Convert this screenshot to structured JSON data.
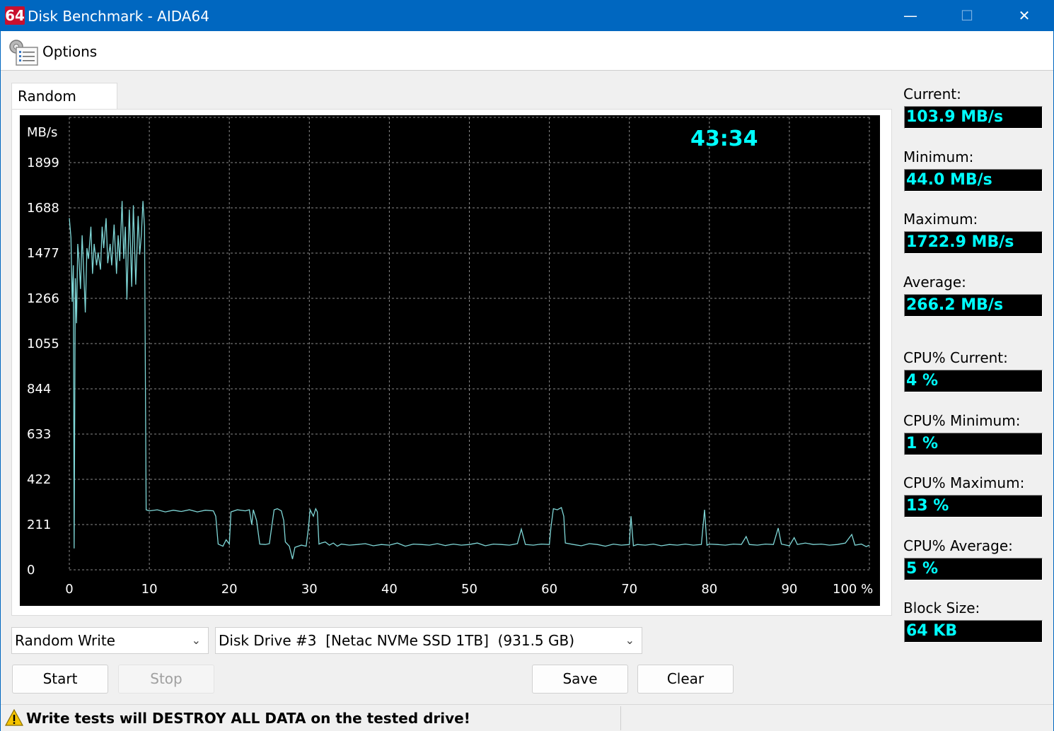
{
  "window": {
    "app_icon_text": "64",
    "title": "Disk Benchmark - AIDA64",
    "minimize_glyph": "—",
    "maximize_glyph": "☐",
    "close_glyph": "✕"
  },
  "menu": {
    "options_label": "Options",
    "options_icon": "options-icon"
  },
  "tab": {
    "label": "Random Write"
  },
  "chart_data": {
    "type": "line",
    "ylabel": "MB/s",
    "xlabel": "",
    "x_unit_suffix": "%",
    "timer_text": "43:34",
    "y_ticks": [
      0,
      211,
      422,
      633,
      844,
      1055,
      1266,
      1477,
      1688,
      1899
    ],
    "x_ticks": [
      "0",
      "10",
      "20",
      "30",
      "40",
      "50",
      "60",
      "70",
      "80",
      "90",
      "100 %"
    ],
    "xlim": [
      0,
      100
    ],
    "ylim": [
      0,
      2110
    ],
    "grid": true,
    "line_color": "#7fd7d7",
    "series": [
      {
        "values": [
          [
            0.0,
            1640
          ],
          [
            0.2,
            1550
          ],
          [
            0.35,
            1250
          ],
          [
            0.5,
            1420
          ],
          [
            0.6,
            100
          ],
          [
            0.75,
            1360
          ],
          [
            0.9,
            1150
          ],
          [
            1.05,
            1520
          ],
          [
            1.2,
            1450
          ],
          [
            1.4,
            1310
          ],
          [
            1.6,
            1560
          ],
          [
            1.8,
            1390
          ],
          [
            2.0,
            1200
          ],
          [
            2.2,
            1500
          ],
          [
            2.4,
            1450
          ],
          [
            2.7,
            1600
          ],
          [
            2.9,
            1380
          ],
          [
            3.1,
            1520
          ],
          [
            3.4,
            1420
          ],
          [
            3.6,
            1480
          ],
          [
            3.9,
            1400
          ],
          [
            4.1,
            1600
          ],
          [
            4.3,
            1500
          ],
          [
            4.6,
            1640
          ],
          [
            4.8,
            1430
          ],
          [
            5.1,
            1520
          ],
          [
            5.3,
            1420
          ],
          [
            5.6,
            1610
          ],
          [
            5.9,
            1380
          ],
          [
            6.1,
            1560
          ],
          [
            6.3,
            1440
          ],
          [
            6.6,
            1720
          ],
          [
            6.8,
            1450
          ],
          [
            7.0,
            1600
          ],
          [
            7.2,
            1260
          ],
          [
            7.5,
            1680
          ],
          [
            7.8,
            1320
          ],
          [
            8.0,
            1700
          ],
          [
            8.3,
            1330
          ],
          [
            8.6,
            1650
          ],
          [
            8.8,
            1470
          ],
          [
            9.0,
            1560
          ],
          [
            9.2,
            1720
          ],
          [
            9.4,
            1600
          ],
          [
            9.6,
            280
          ],
          [
            10,
            275
          ],
          [
            11,
            280
          ],
          [
            12,
            270
          ],
          [
            13,
            278
          ],
          [
            14,
            272
          ],
          [
            15,
            280
          ],
          [
            16,
            270
          ],
          [
            17,
            278
          ],
          [
            18,
            275
          ],
          [
            18.3,
            250
          ],
          [
            18.6,
            120
          ],
          [
            19.2,
            110
          ],
          [
            19.6,
            140
          ],
          [
            20,
            120
          ],
          [
            20.2,
            270
          ],
          [
            21,
            280
          ],
          [
            22,
            275
          ],
          [
            22.5,
            280
          ],
          [
            22.8,
            210
          ],
          [
            23,
            280
          ],
          [
            23.4,
            230
          ],
          [
            23.8,
            120
          ],
          [
            24.5,
            118
          ],
          [
            25,
            122
          ],
          [
            25.3,
            200
          ],
          [
            25.6,
            280
          ],
          [
            26,
            285
          ],
          [
            26.5,
            275
          ],
          [
            26.8,
            230
          ],
          [
            27,
            130
          ],
          [
            27.5,
            110
          ],
          [
            27.9,
            50
          ],
          [
            28.2,
            105
          ],
          [
            29,
            115
          ],
          [
            29.6,
            110
          ],
          [
            29.9,
            200
          ],
          [
            30.1,
            280
          ],
          [
            30.5,
            250
          ],
          [
            30.8,
            285
          ],
          [
            31,
            270
          ],
          [
            31.2,
            120
          ],
          [
            31.5,
            125
          ],
          [
            32,
            130
          ],
          [
            32.5,
            115
          ],
          [
            33,
            125
          ],
          [
            33.5,
            110
          ],
          [
            34,
            120
          ],
          [
            35,
            115
          ],
          [
            36,
            118
          ],
          [
            37,
            122
          ],
          [
            38,
            112
          ],
          [
            39,
            118
          ],
          [
            40,
            115
          ],
          [
            41,
            125
          ],
          [
            42,
            110
          ],
          [
            43,
            120
          ],
          [
            44,
            118
          ],
          [
            45,
            115
          ],
          [
            46,
            122
          ],
          [
            47,
            113
          ],
          [
            48,
            120
          ],
          [
            49,
            115
          ],
          [
            50,
            118
          ],
          [
            51,
            125
          ],
          [
            52,
            112
          ],
          [
            53,
            120
          ],
          [
            54,
            118
          ],
          [
            55,
            115
          ],
          [
            56,
            122
          ],
          [
            56.5,
            190
          ],
          [
            57,
            118
          ],
          [
            58,
            115
          ],
          [
            59,
            120
          ],
          [
            60,
            118
          ],
          [
            60.2,
            200
          ],
          [
            60.5,
            285
          ],
          [
            61,
            280
          ],
          [
            61.5,
            290
          ],
          [
            61.8,
            250
          ],
          [
            62,
            125
          ],
          [
            63,
            118
          ],
          [
            64,
            112
          ],
          [
            65,
            122
          ],
          [
            66,
            118
          ],
          [
            67,
            110
          ],
          [
            68,
            120
          ],
          [
            69,
            115
          ],
          [
            70,
            118
          ],
          [
            70.2,
            250
          ],
          [
            70.5,
            112
          ],
          [
            71,
            118
          ],
          [
            72,
            115
          ],
          [
            73,
            120
          ],
          [
            74,
            112
          ],
          [
            75,
            118
          ],
          [
            76,
            115
          ],
          [
            77,
            120
          ],
          [
            78,
            115
          ],
          [
            79,
            118
          ],
          [
            79.4,
            280
          ],
          [
            79.7,
            115
          ],
          [
            80,
            120
          ],
          [
            81,
            118
          ],
          [
            82,
            115
          ],
          [
            83,
            120
          ],
          [
            84,
            118
          ],
          [
            84.6,
            155
          ],
          [
            85,
            118
          ],
          [
            86,
            115
          ],
          [
            87,
            120
          ],
          [
            88,
            118
          ],
          [
            88.6,
            195
          ],
          [
            89,
            120
          ],
          [
            90,
            112
          ],
          [
            90.6,
            150
          ],
          [
            91,
            118
          ],
          [
            92,
            125
          ],
          [
            93,
            118
          ],
          [
            94,
            120
          ],
          [
            95,
            115
          ],
          [
            96,
            118
          ],
          [
            97,
            125
          ],
          [
            97.8,
            165
          ],
          [
            98.2,
            115
          ],
          [
            99,
            120
          ],
          [
            99.6,
            108
          ],
          [
            100,
            115
          ]
        ]
      }
    ]
  },
  "stats": [
    {
      "label": "Current:",
      "value": "103.9 MB/s"
    },
    {
      "label": "Minimum:",
      "value": "44.0 MB/s"
    },
    {
      "label": "Maximum:",
      "value": "1722.9 MB/s"
    },
    {
      "label": "Average:",
      "value": "266.2 MB/s"
    },
    {
      "label": "CPU% Current:",
      "value": "4 %"
    },
    {
      "label": "CPU% Minimum:",
      "value": "1 %"
    },
    {
      "label": "CPU% Maximum:",
      "value": "13 %"
    },
    {
      "label": "CPU% Average:",
      "value": "5 %"
    },
    {
      "label": "Block Size:",
      "value": "64 KB"
    }
  ],
  "controls": {
    "test_select_value": "Random Write",
    "drive_select_value": "Disk Drive #3  [Netac NVMe SSD 1TB]  (931.5 GB)",
    "caret_glyph": "⌄",
    "start_label": "Start",
    "stop_label": "Stop",
    "save_label": "Save",
    "clear_label": "Clear"
  },
  "status": {
    "warning_icon": "warning-icon",
    "warning_text": "Write tests will DESTROY ALL DATA on the tested drive!"
  }
}
